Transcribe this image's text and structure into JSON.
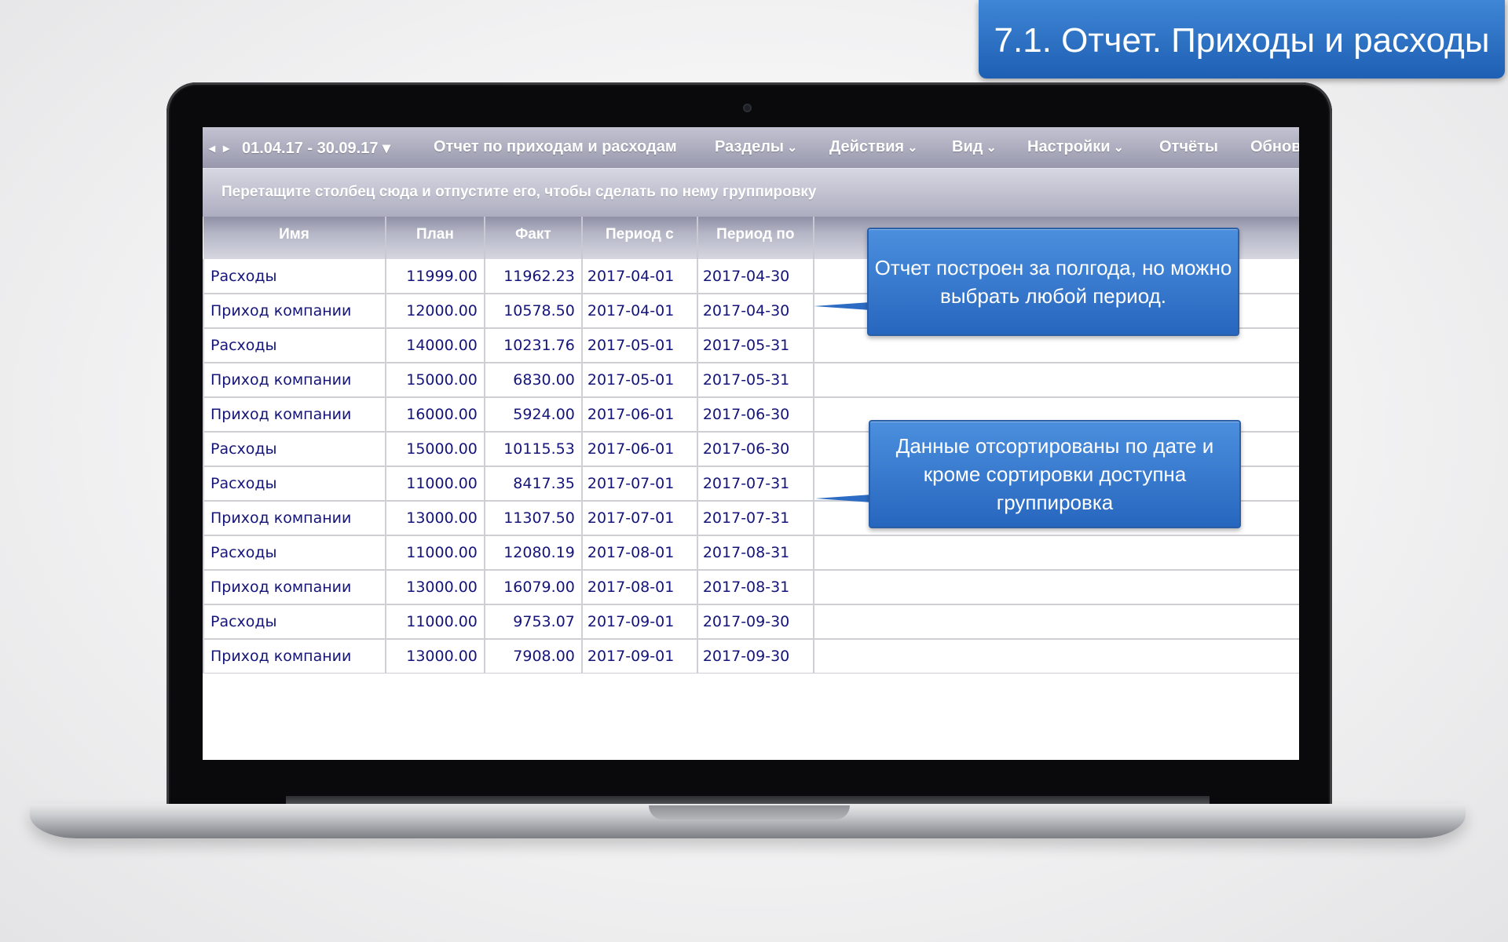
{
  "slide_title": "7.1. Отчет. Приходы и расходы",
  "menubar": {
    "prev_arrow": "◂",
    "next_arrow": "▸",
    "date_range": "01.04.17 - 30.09.17",
    "date_range_caret": "▾",
    "report_title": "Отчет по приходам и расходам",
    "menus": [
      {
        "label": "Разделы"
      },
      {
        "label": "Действия"
      },
      {
        "label": "Вид"
      },
      {
        "label": "Настройки"
      },
      {
        "label": "Отчёты"
      },
      {
        "label": "Обнов"
      }
    ],
    "chevron": "⌄"
  },
  "group_hint": "Перетащите столбец сюда и отпустите его, чтобы сделать по нему группировку",
  "table": {
    "columns": [
      "Имя",
      "План",
      "Факт",
      "Период с",
      "Период по"
    ],
    "rows": [
      [
        "Расходы",
        "11999.00",
        "11962.23",
        "2017-04-01",
        "2017-04-30"
      ],
      [
        "Приход компании",
        "12000.00",
        "10578.50",
        "2017-04-01",
        "2017-04-30"
      ],
      [
        "Расходы",
        "14000.00",
        "10231.76",
        "2017-05-01",
        "2017-05-31"
      ],
      [
        "Приход компании",
        "15000.00",
        "6830.00",
        "2017-05-01",
        "2017-05-31"
      ],
      [
        "Приход компании",
        "16000.00",
        "5924.00",
        "2017-06-01",
        "2017-06-30"
      ],
      [
        "Расходы",
        "15000.00",
        "10115.53",
        "2017-06-01",
        "2017-06-30"
      ],
      [
        "Расходы",
        "11000.00",
        "8417.35",
        "2017-07-01",
        "2017-07-31"
      ],
      [
        "Приход компании",
        "13000.00",
        "11307.50",
        "2017-07-01",
        "2017-07-31"
      ],
      [
        "Расходы",
        "11000.00",
        "12080.19",
        "2017-08-01",
        "2017-08-31"
      ],
      [
        "Приход компании",
        "13000.00",
        "16079.00",
        "2017-08-01",
        "2017-08-31"
      ],
      [
        "Расходы",
        "11000.00",
        "9753.07",
        "2017-09-01",
        "2017-09-30"
      ],
      [
        "Приход компании",
        "13000.00",
        "7908.00",
        "2017-09-01",
        "2017-09-30"
      ]
    ]
  },
  "callouts": {
    "period": "Отчет построен за полгода, но можно выбрать любой период.",
    "sorting": "Данные отсортированы по дате и кроме сортировки доступна группировка"
  },
  "colors": {
    "accent": "#2d6cc4",
    "header_bar": "#9798ac",
    "cell_text": "#14147a"
  }
}
